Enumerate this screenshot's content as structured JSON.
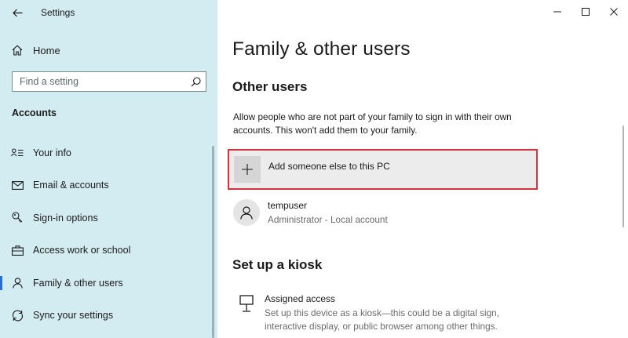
{
  "window": {
    "title": "Settings",
    "controls": {
      "minimize": "minimize-icon",
      "maximize": "maximize-icon",
      "close": "close-icon"
    }
  },
  "sidebar": {
    "home_label": "Home",
    "search_placeholder": "Find a setting",
    "section_heading": "Accounts",
    "items": [
      {
        "label": "Your info",
        "icon": "contact-info-icon",
        "selected": false
      },
      {
        "label": "Email & accounts",
        "icon": "mail-icon",
        "selected": false
      },
      {
        "label": "Sign-in options",
        "icon": "key-icon",
        "selected": false
      },
      {
        "label": "Access work or school",
        "icon": "briefcase-icon",
        "selected": false
      },
      {
        "label": "Family & other users",
        "icon": "person-icon",
        "selected": true
      },
      {
        "label": "Sync your settings",
        "icon": "sync-icon",
        "selected": false
      }
    ]
  },
  "main": {
    "title": "Family & other users",
    "other_users": {
      "heading": "Other users",
      "description": "Allow people who are not part of your family to sign in with their own accounts. This won't add them to your family.",
      "add_label": "Add someone else to this PC",
      "users": [
        {
          "name": "tempuser",
          "details": "Administrator - Local account"
        }
      ]
    },
    "kiosk": {
      "heading": "Set up a kiosk",
      "item_title": "Assigned access",
      "item_description": "Set up this device as a kiosk—this could be a digital sign, interactive display, or public browser among other things."
    }
  },
  "colors": {
    "sidebar_bg": "#d3ecf1",
    "accent": "#2a6fcf",
    "highlight_border": "#d4343d"
  }
}
